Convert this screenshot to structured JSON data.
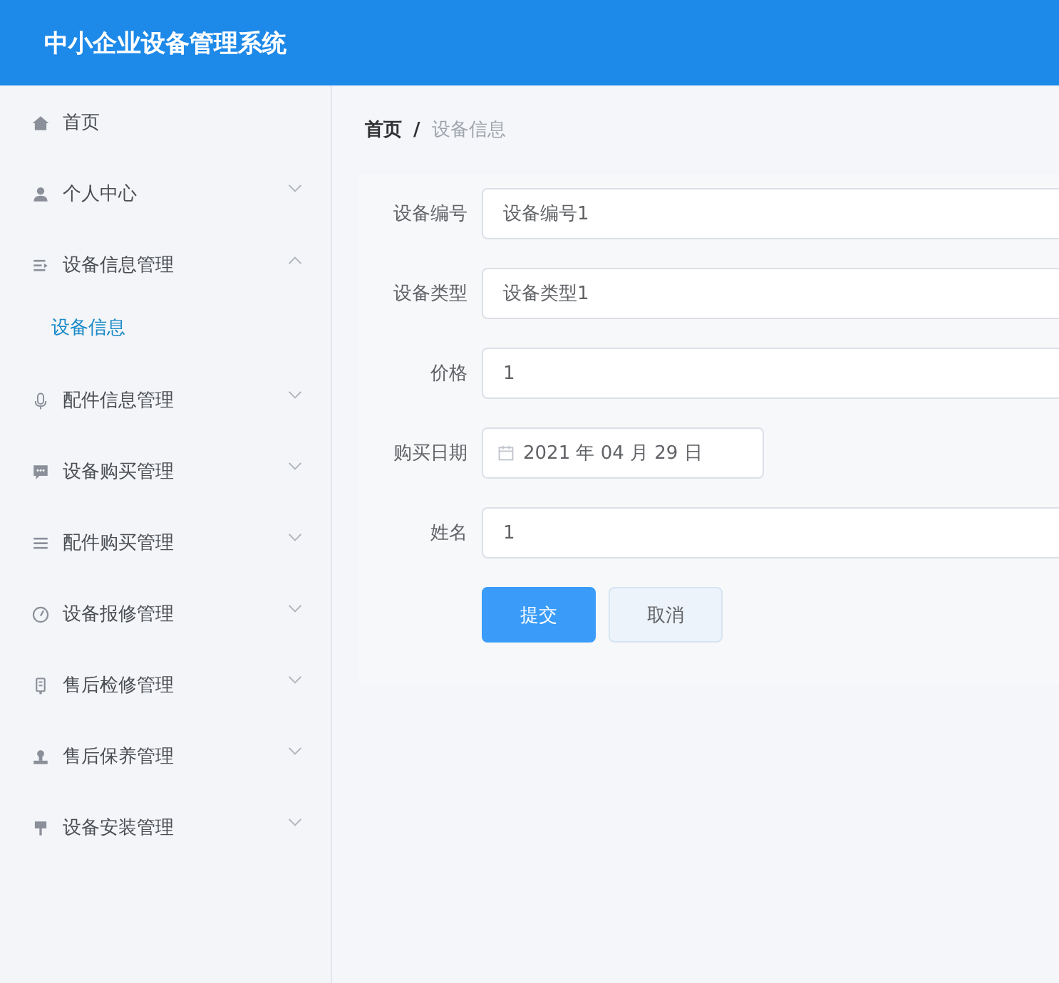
{
  "header": {
    "title": "中小企业设备管理系统"
  },
  "sidebar": {
    "items": [
      {
        "label": "首页",
        "kind": "link"
      },
      {
        "label": "个人中心",
        "kind": "submenu",
        "expanded": false
      },
      {
        "label": "设备信息管理",
        "kind": "submenu",
        "expanded": true,
        "children": [
          {
            "label": "设备信息",
            "selected": true
          }
        ]
      },
      {
        "label": "配件信息管理",
        "kind": "submenu",
        "expanded": false
      },
      {
        "label": "设备购买管理",
        "kind": "submenu",
        "expanded": false
      },
      {
        "label": "配件购买管理",
        "kind": "submenu",
        "expanded": false
      },
      {
        "label": "设备报修管理",
        "kind": "submenu",
        "expanded": false
      },
      {
        "label": "售后检修管理",
        "kind": "submenu",
        "expanded": false
      },
      {
        "label": "售后保养管理",
        "kind": "submenu",
        "expanded": false
      },
      {
        "label": "设备安装管理",
        "kind": "submenu",
        "expanded": false
      }
    ]
  },
  "breadcrumb": {
    "separator": "/",
    "items": [
      {
        "label": "首页"
      },
      {
        "label": "设备信息"
      }
    ]
  },
  "form": {
    "fields": [
      {
        "label": "设备编号",
        "value": "设备编号1",
        "kind": "text"
      },
      {
        "label": "设备类型",
        "value": "设备类型1",
        "kind": "text"
      },
      {
        "label": "价格",
        "value": "1",
        "kind": "text"
      },
      {
        "label": "购买日期",
        "value": "2021 年 04 月 29 日",
        "kind": "date"
      },
      {
        "label": "姓名",
        "value": "1",
        "kind": "text"
      }
    ],
    "buttons": [
      {
        "label": "提交",
        "kind": "primary"
      },
      {
        "label": "取消",
        "kind": "default"
      }
    ]
  }
}
